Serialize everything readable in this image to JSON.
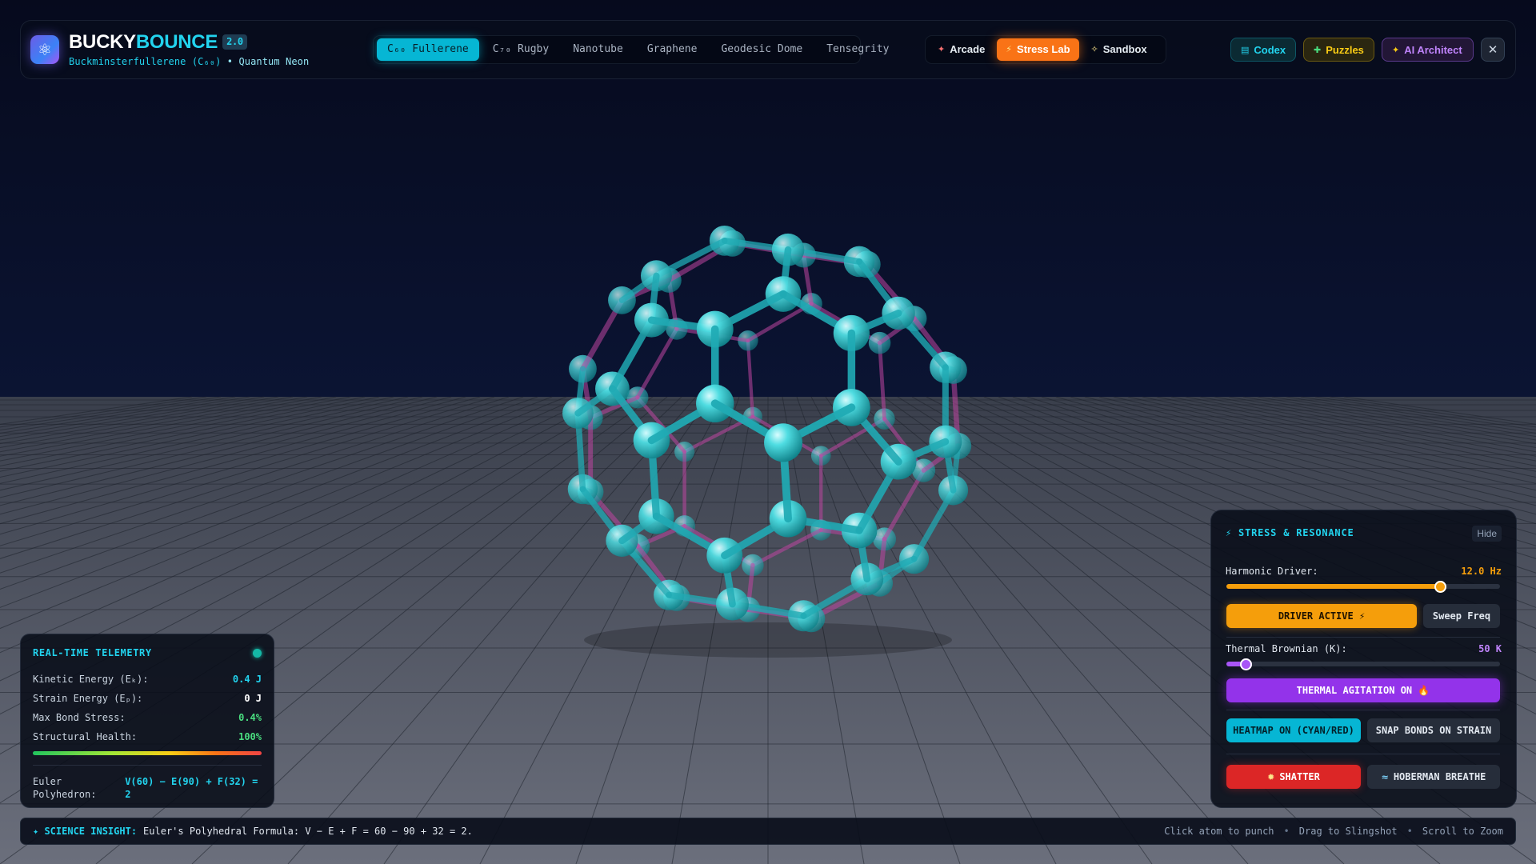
{
  "app": {
    "title_part1": "BUCKY",
    "title_part2": "BOUNCE",
    "version": "2.0",
    "subtitle_molecule": "Buckminsterfullerene (C₆₀)",
    "subtitle_separator": "•",
    "subtitle_theme": "Quantum Neon",
    "logo_icon": "atom-icon"
  },
  "model_tabs": [
    {
      "label": "C₆₀ Fullerene",
      "active": true
    },
    {
      "label": "C₇₀ Rugby",
      "active": false
    },
    {
      "label": "Nanotube",
      "active": false
    },
    {
      "label": "Graphene",
      "active": false
    },
    {
      "label": "Geodesic Dome",
      "active": false
    },
    {
      "label": "Tensegrity",
      "active": false
    }
  ],
  "mode_tabs": [
    {
      "label": "Arcade",
      "icon": "rocket-icon",
      "glyph": "✦",
      "active": false
    },
    {
      "label": "Stress Lab",
      "icon": "lightning-icon",
      "glyph": "⚡",
      "active": true
    },
    {
      "label": "Sandbox",
      "icon": "sparkle-icon",
      "glyph": "✧",
      "active": false
    }
  ],
  "actions": {
    "codex": {
      "label": "Codex",
      "icon": "book-icon",
      "glyph": "▤"
    },
    "puzzles": {
      "label": "Puzzles",
      "icon": "puzzle-icon",
      "glyph": "✚"
    },
    "ai_architect": {
      "label": "AI Architect",
      "icon": "sparkles-icon",
      "glyph": "✦"
    },
    "settings_icon": "mute-icon"
  },
  "telemetry": {
    "title": "REAL-TIME TELEMETRY",
    "status_color": "#14b8a6",
    "rows": [
      {
        "label": "Kinetic Energy (Eₖ):",
        "value": "0.4 J"
      },
      {
        "label": "Strain Energy (Eₚ):",
        "value": "0 J"
      },
      {
        "label": "Max Bond Stress:",
        "value": "0.4%"
      },
      {
        "label": "Structural Health:",
        "value": "100%"
      }
    ],
    "euler_label": "Euler Polyhedron:",
    "euler_value": "V(60) − E(90) + F(32) = 2"
  },
  "stress_panel": {
    "title": "⚡ STRESS & RESONANCE",
    "hide_label": "Hide",
    "harmonic": {
      "label": "Harmonic Driver:",
      "value": "12.0 Hz",
      "fraction": 0.78
    },
    "driver_button": "DRIVER ACTIVE ⚡",
    "sweep_button": "Sweep Freq",
    "thermal": {
      "label": "Thermal Brownian (K):",
      "value": "50 K",
      "fraction": 0.07
    },
    "thermal_button": "THERMAL AGITATION ON 🔥",
    "heatmap_button": "HEATMAP ON (CYAN/RED)",
    "snap_button": "SNAP BONDS ON STRAIN",
    "shatter_button": "SHATTER",
    "shatter_icon": "explosion-icon",
    "hoberman_button": "HOBERMAN BREATHE",
    "hoberman_icon": "wave-icon"
  },
  "insight": {
    "label": "✦ SCIENCE INSIGHT:",
    "text": "Euler's Polyhedral Formula: V − E + F = 60 − 90 + 32 = 2."
  },
  "hints": [
    "Click atom to punch",
    "Drag to Slingshot",
    "Scroll to Zoom"
  ],
  "colors": {
    "accent": "#22d3ee",
    "active_mode": "#f97316",
    "driver": "#f59e0b",
    "thermal": "#9333ea",
    "shatter": "#dc2626",
    "atom": "#2fc9d0"
  }
}
